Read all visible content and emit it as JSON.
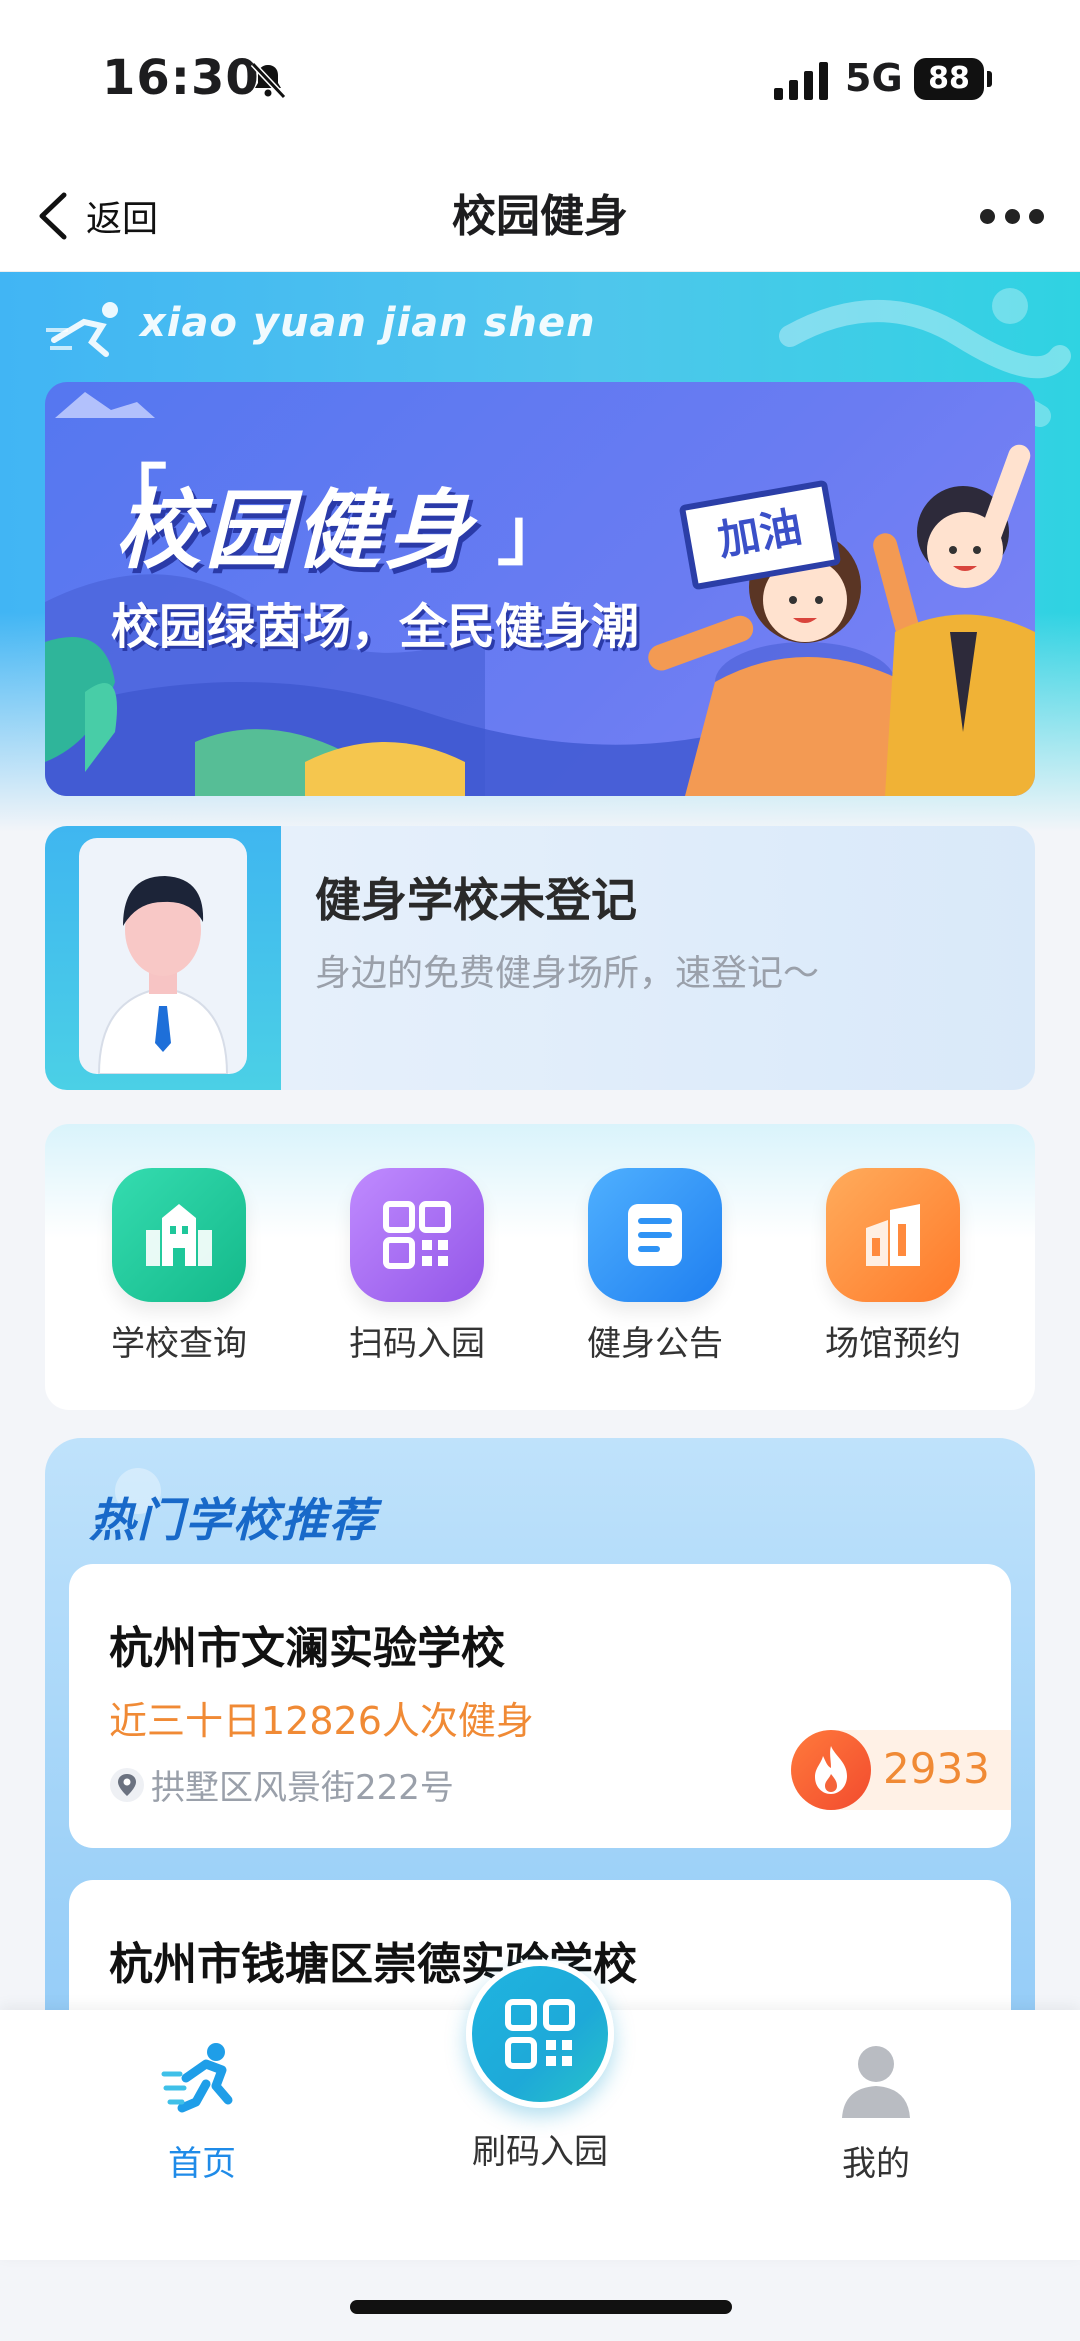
{
  "status": {
    "time": "16:30",
    "network": "5G",
    "battery": "88"
  },
  "nav": {
    "back_label": "返回",
    "title": "校园健身"
  },
  "header": {
    "brand_pinyin": "xiao yuan jian shen"
  },
  "banner": {
    "title": "校园健身",
    "subtitle": "校园绿茵场，全民健身潮",
    "sign_text": "加油"
  },
  "register": {
    "title": "健身学校未登记",
    "subtitle": "身边的免费健身场所，速登记～"
  },
  "quick_actions": [
    {
      "label": "学校查询",
      "icon": "school-building-icon",
      "color": "#1fc79a"
    },
    {
      "label": "扫码入园",
      "icon": "qr-code-icon",
      "color": "#a66af0"
    },
    {
      "label": "健身公告",
      "icon": "notice-document-icon",
      "color": "#2f93f5"
    },
    {
      "label": "场馆预约",
      "icon": "venue-building-icon",
      "color": "#ff8a3d"
    }
  ],
  "hot_schools": {
    "title": "热门学校推荐",
    "items": [
      {
        "name": "杭州市文澜实验学校",
        "stat": "近三十日12826人次健身",
        "address": "拱墅区风景街222号",
        "heat": "2933"
      },
      {
        "name": "杭州市钱塘区崇德实验学校"
      }
    ]
  },
  "tabbar": {
    "home": "首页",
    "scan": "刷码入园",
    "me": "我的"
  },
  "colors": {
    "brand_blue": "#1f8be8",
    "accent_orange": "#f08a35",
    "header_cyan": "#41b5f4"
  }
}
